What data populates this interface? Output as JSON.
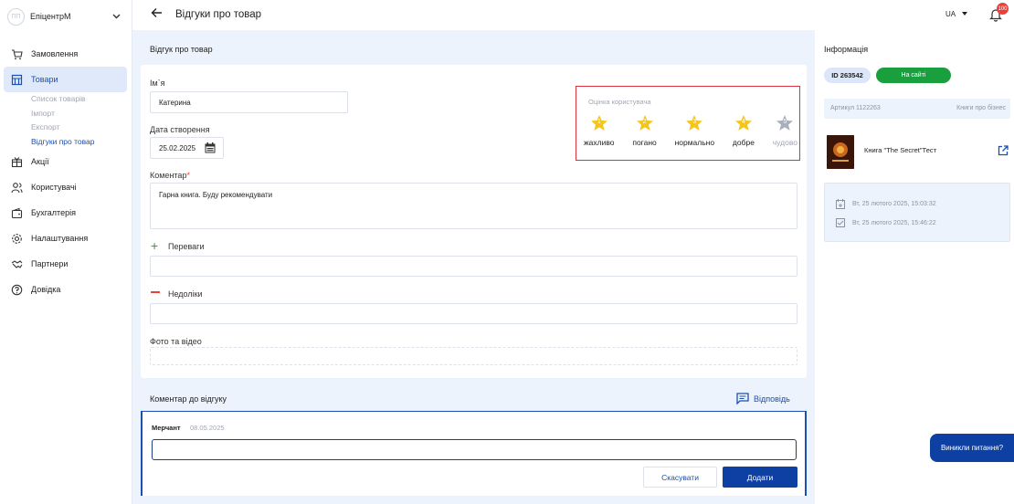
{
  "brand": {
    "logo_text": "ПП",
    "name": "ЕпіцентрМ"
  },
  "sidebar": {
    "items": [
      {
        "label": "Замовлення",
        "icon": "cart-icon"
      },
      {
        "label": "Товари",
        "icon": "store-icon",
        "active": true
      },
      {
        "label": "Акції",
        "icon": "promo-icon"
      },
      {
        "label": "Користувачі",
        "icon": "users-icon"
      },
      {
        "label": "Бухгалтерія",
        "icon": "wallet-icon"
      },
      {
        "label": "Налаштування",
        "icon": "gear-icon"
      },
      {
        "label": "Партнери",
        "icon": "handshake-icon"
      },
      {
        "label": "Довідка",
        "icon": "help-icon"
      }
    ],
    "sub_items": [
      {
        "label": "Список товарів"
      },
      {
        "label": "Імпорт"
      },
      {
        "label": "Експорт"
      },
      {
        "label": "Відгуки про товар",
        "active": true
      }
    ]
  },
  "header": {
    "title": "Відгуки про товар",
    "lang": "UA",
    "notifications": "100"
  },
  "review": {
    "section_title": "Відгук про товар",
    "name_label": "Ім`я",
    "name_value": "Катерина",
    "date_label": "Дата створення",
    "date_value": "25.02.2025",
    "comment_label": "Коментар",
    "comment_required": "*",
    "comment_value": "Гарна книга. Буду рекомендувати",
    "pros_label": "Переваги",
    "pros_value": "",
    "cons_label": "Недоліки",
    "cons_value": "",
    "media_label": "Фото та відео"
  },
  "rating": {
    "title": "Оцінка користувача",
    "value": 4,
    "max": 5,
    "stars": [
      {
        "num": "1",
        "label": "жахливо"
      },
      {
        "num": "2",
        "label": "погано"
      },
      {
        "num": "3",
        "label": "нормально"
      },
      {
        "num": "4",
        "label": "добре"
      },
      {
        "num": "5",
        "label": "чудово"
      }
    ]
  },
  "reply": {
    "section_title": "Коментар до відгуку",
    "reply_link": "Відповідь",
    "author": "Мерчант",
    "date": "08.05.2025",
    "input_value": "",
    "cancel_label": "Скасувати",
    "add_label": "Додати"
  },
  "info": {
    "title": "Інформація",
    "id": "ID 263542",
    "status": "На сайті",
    "article": "Артикул 1122263",
    "category": "Книги про бізнес",
    "product_name": "Книга \"The Secret\"Тест",
    "created": "Вт, 25 лютого 2025, 15:03:32",
    "updated": "Вт, 25 лютого 2025, 15:46:22"
  },
  "help_button": "Виникли питання?",
  "colors": {
    "primary": "#0e3fa3",
    "accent_blue": "#1b4fb0",
    "star_filled": "#f5c518",
    "star_empty": "#a9b0bd",
    "success": "#1a9f3e",
    "danger": "#e8403b"
  }
}
